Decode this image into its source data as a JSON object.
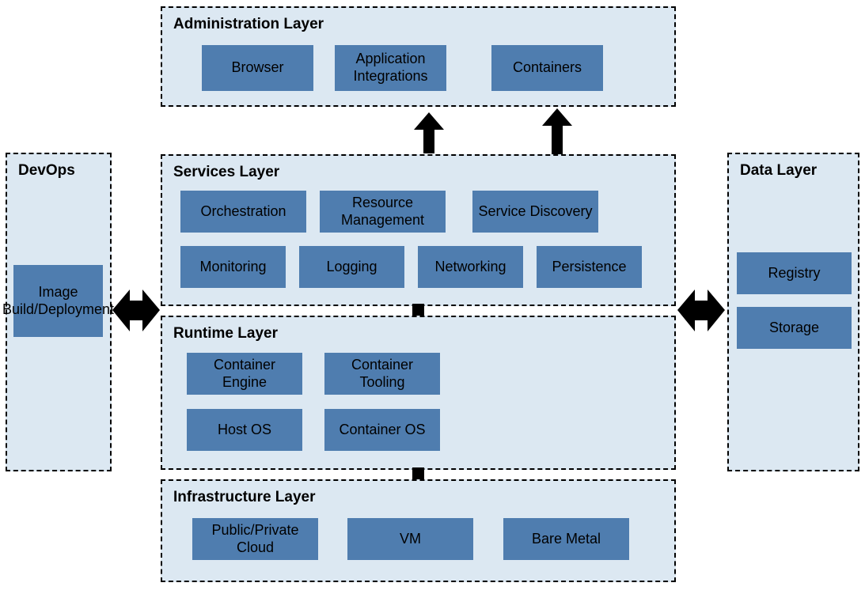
{
  "layers": {
    "admin": {
      "title": "Administration Layer",
      "blocks": {
        "browser": "Browser",
        "appint": "Application Integrations",
        "containers": "Containers"
      }
    },
    "services": {
      "title": "Services Layer",
      "blocks": {
        "orchestration": "Orchestration",
        "resource": "Resource Management",
        "discovery": "Service Discovery",
        "monitoring": "Monitoring",
        "logging": "Logging",
        "networking": "Networking",
        "persistence": "Persistence"
      }
    },
    "runtime": {
      "title": "Runtime Layer",
      "blocks": {
        "engine": "Container Engine",
        "tooling": "Container Tooling",
        "hostos": "Host OS",
        "cos": "Container OS"
      }
    },
    "infra": {
      "title": "Infrastructure Layer",
      "blocks": {
        "cloud": "Public/Private Cloud",
        "vm": "VM",
        "bare": "Bare Metal"
      }
    },
    "devops": {
      "title": "DevOps",
      "blocks": {
        "image": "Image Build/Deployment"
      }
    },
    "data": {
      "title": "Data Layer",
      "blocks": {
        "registry": "Registry",
        "storage": "Storage"
      }
    }
  },
  "colors": {
    "box_bg": "#dce8f2",
    "block_bg": "#4f7daf"
  }
}
